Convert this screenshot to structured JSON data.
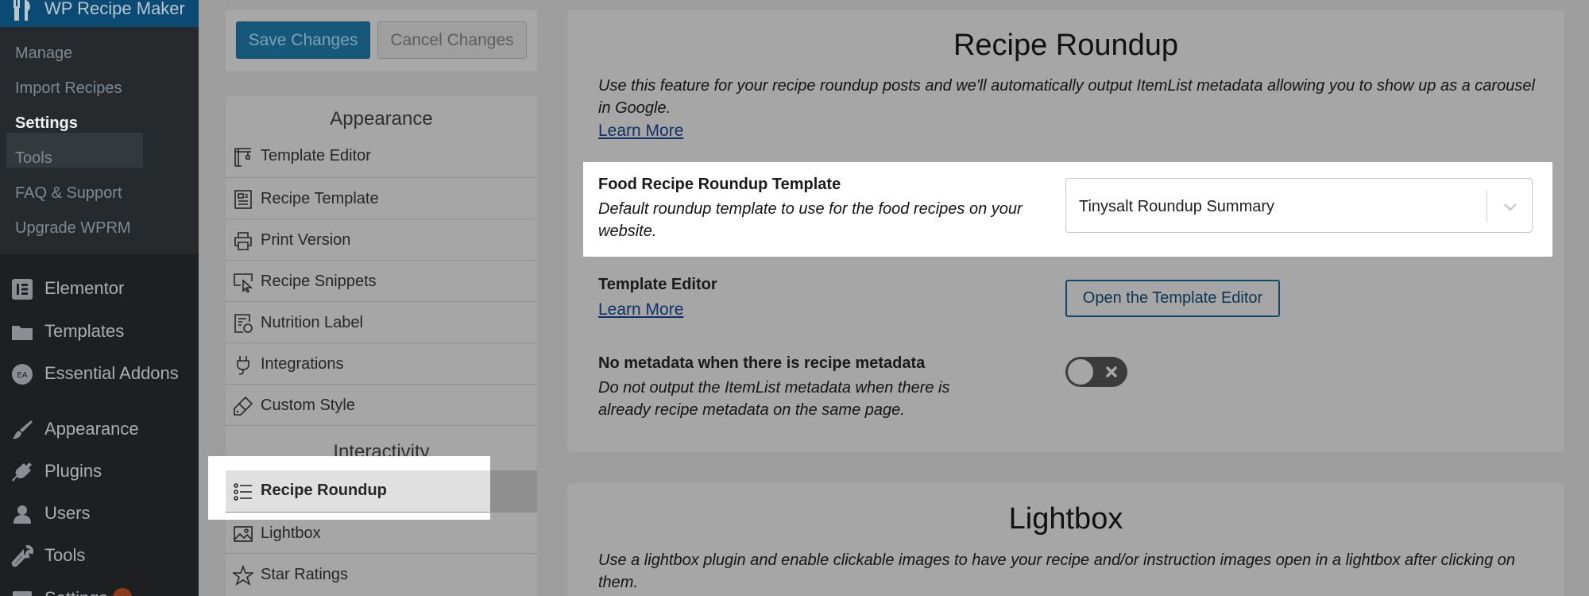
{
  "admin_menu": {
    "plugin_title": "WP Recipe Maker",
    "submenu": [
      {
        "label": "Manage"
      },
      {
        "label": "Import Recipes"
      },
      {
        "label": "Settings"
      },
      {
        "label": "Tools"
      },
      {
        "label": "FAQ & Support"
      },
      {
        "label": "Upgrade WPRM"
      }
    ],
    "items": [
      {
        "label": "Elementor",
        "icon": "elementor-icon"
      },
      {
        "label": "Templates",
        "icon": "folder-icon"
      },
      {
        "label": "Essential Addons",
        "icon": "essential-addons-icon"
      },
      {
        "label": "Appearance",
        "icon": "paintbrush-icon"
      },
      {
        "label": "Plugins",
        "icon": "plug-icon"
      },
      {
        "label": "Users",
        "icon": "user-icon"
      },
      {
        "label": "Tools",
        "icon": "wrench-icon"
      },
      {
        "label": "Settings",
        "icon": "settings-icon"
      }
    ]
  },
  "actions": {
    "save_label": "Save Changes",
    "cancel_label": "Cancel Changes"
  },
  "settings_nav": {
    "appearance_heading": "Appearance",
    "appearance_items": [
      {
        "label": "Template Editor",
        "icon": "crane-icon"
      },
      {
        "label": "Recipe Template",
        "icon": "document-icon"
      },
      {
        "label": "Print Version",
        "icon": "printer-icon"
      },
      {
        "label": "Recipe Snippets",
        "icon": "cursor-select-icon"
      },
      {
        "label": "Nutrition Label",
        "icon": "nutrition-icon"
      },
      {
        "label": "Integrations",
        "icon": "plug-icon"
      },
      {
        "label": "Custom Style",
        "icon": "brush-icon"
      }
    ],
    "interactivity_heading": "Interactivity",
    "interactivity_items": [
      {
        "label": "Recipe Roundup",
        "icon": "list-icon",
        "active": true
      },
      {
        "label": "Lightbox",
        "icon": "image-icon"
      },
      {
        "label": "Star Ratings",
        "icon": "star-icon"
      }
    ]
  },
  "roundup": {
    "title": "Recipe Roundup",
    "description": "Use this feature for your recipe roundup posts and we'll automatically output ItemList metadata allowing you to show up as a carousel in Google.",
    "learn_more": "Learn More",
    "template_setting": {
      "label": "Food Recipe Roundup Template",
      "description": "Default roundup template to use for the food recipes on your website.",
      "value": "Tinysalt Roundup Summary"
    },
    "editor_setting": {
      "label": "Template Editor",
      "learn_more": "Learn More",
      "button": "Open the Template Editor"
    },
    "metadata_setting": {
      "label": "No metadata when there is recipe metadata",
      "description": "Do not output the ItemList metadata when there is already recipe metadata on the same page.",
      "enabled": false
    }
  },
  "lightbox": {
    "title": "Lightbox",
    "description": "Use a lightbox plugin and enable clickable images to have your recipe and/or instruction images open in a lightbox after clicking on them."
  },
  "colors": {
    "admin_bg": "#1d1f21",
    "overlay_bg": "#9e9e9e",
    "primary_button": "#17577a",
    "link": "#102f66",
    "highlight": "#ffffff"
  }
}
